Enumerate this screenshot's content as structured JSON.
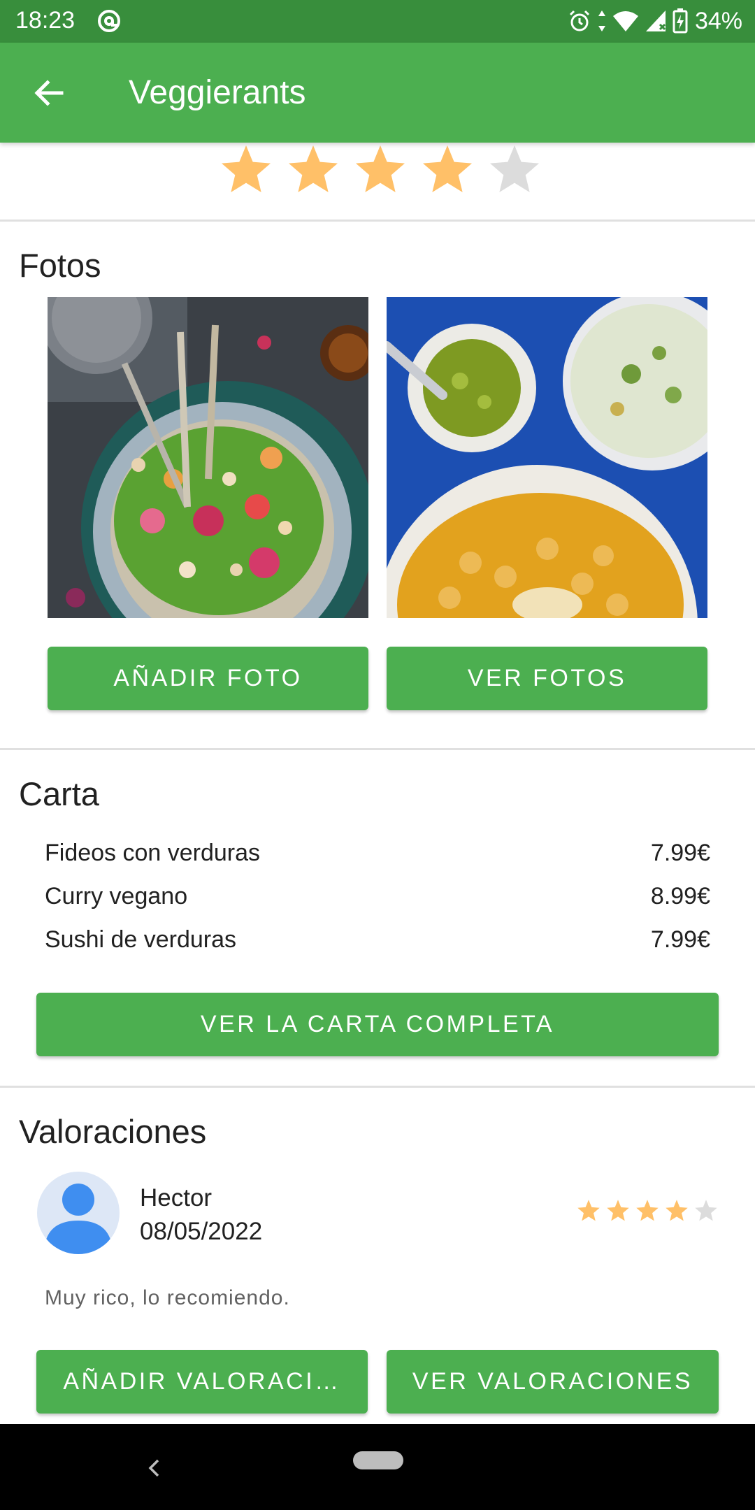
{
  "status_bar": {
    "time": "18:23",
    "battery": "34%"
  },
  "app_bar": {
    "title": "Veggierants"
  },
  "restaurant": {
    "rating": 4,
    "rating_max": 5
  },
  "photos": {
    "title": "Fotos",
    "add_button": "AÑADIR FOTO",
    "view_button": "VER FOTOS"
  },
  "menu": {
    "title": "Carta",
    "items": [
      {
        "name": "Fideos con verduras",
        "price": "7.99€"
      },
      {
        "name": "Curry vegano",
        "price": "8.99€"
      },
      {
        "name": "Sushi de verduras",
        "price": "7.99€"
      }
    ],
    "full_menu_button": "VER LA CARTA COMPLETA"
  },
  "reviews": {
    "title": "Valoraciones",
    "items": [
      {
        "author": "Hector",
        "date": "08/05/2022",
        "rating": 4,
        "text": "Muy rico, lo recomiendo."
      }
    ],
    "add_button": "AÑADIR VALORACI…",
    "view_button": "VER VALORACIONES"
  },
  "colors": {
    "primary": "#4caf50",
    "primary_dark": "#388e3c",
    "star_filled": "#ffc068",
    "star_empty": "#dcdcdc"
  }
}
